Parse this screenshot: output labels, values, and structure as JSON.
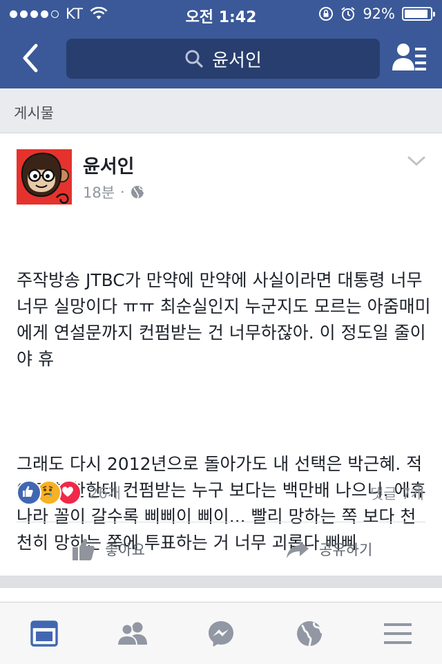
{
  "status_bar": {
    "carrier": "KT",
    "time": "오전 1:42",
    "battery_percent": "92%",
    "battery_level": 0.92,
    "signal_bars_filled": 4
  },
  "nav": {
    "search_text": "윤서인",
    "back_icon": "chevron-left-icon",
    "friends_icon": "friend-list-icon"
  },
  "section": {
    "label": "게시물"
  },
  "post": {
    "author": "윤서인",
    "time": "18분",
    "separator": "·",
    "privacy_icon": "globe-icon",
    "paragraphs": [
      "주작방송 JTBC가 만약에 만약에 사실이라면 대통령 너무너무 실망이다 ㅠㅠ 최순실인지 누군지도 모르는 아줌매미에게 연설문까지 컨펌받는 건 너무하잖아. 이 정도일 줄이야 휴",
      "그래도 다시 2012년으로 돌아가도 내 선택은 박근혜. 적어도 북한한테 컨펌받는 누구 보다는 백만배 나으니. 에휴 나라 꼴이 갈수록 삐삐이 삐이... 빨리 망하는 쪽 보다 천천히 망하는 쪽에 투표하는 거 너무 괴롭다 삐삐"
    ],
    "reaction_count": "26개",
    "comment_count": "댓글 7개",
    "like_label": "좋아요",
    "share_label": "공유하기"
  },
  "colors": {
    "brand": "#3b5998",
    "search_bg": "#283e6e",
    "like_blue": "#4267b2",
    "sad_yellow": "#f7b125",
    "love_red": "#f0284a",
    "active_tab": "#4267b2",
    "inactive_tab": "#9197a3"
  },
  "tabs": [
    {
      "name": "news-feed",
      "icon": "news-feed-icon",
      "active": true
    },
    {
      "name": "friend-requests",
      "icon": "friends-icon",
      "active": false
    },
    {
      "name": "messenger",
      "icon": "messenger-icon",
      "active": false
    },
    {
      "name": "notifications",
      "icon": "globe-icon",
      "active": false
    },
    {
      "name": "more",
      "icon": "menu-icon",
      "active": false
    }
  ]
}
